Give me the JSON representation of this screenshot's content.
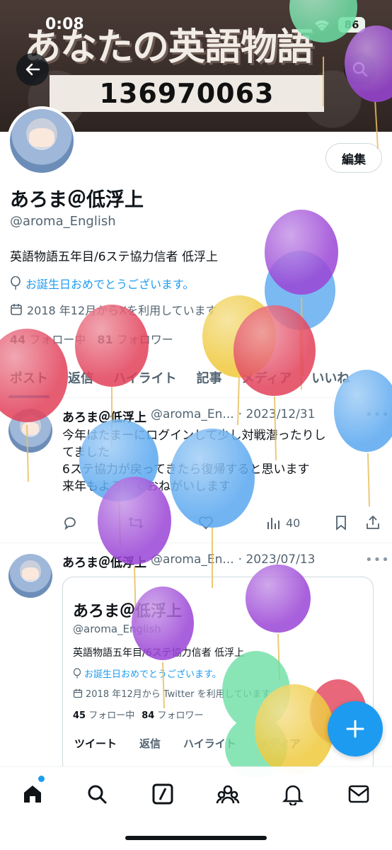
{
  "status_bar": {
    "time": "0:08",
    "battery": "86"
  },
  "banner": {
    "title": "あなたの英語物語",
    "number": "136970063"
  },
  "profile": {
    "edit_label": "編集",
    "display_name": "あろま＠低浮上",
    "handle": "@aroma_English",
    "bio": "英語物語五年目/6ステ協力信者 低浮上",
    "birthday": "お誕生日おめでとうございます。",
    "joined": "2018 年12月からXを利用しています",
    "following_count": "44",
    "following_label": "フォロー中",
    "followers_count": "81",
    "followers_label": "フォロワー"
  },
  "tabs": [
    "ポスト",
    "返信",
    "ハイライト",
    "記事",
    "メディア",
    "いいね"
  ],
  "tweets": [
    {
      "name": "あろま＠低浮上",
      "handle": "@aroma_En...",
      "date": "· 2023/12/31",
      "lines": [
        "今年はたまーにログインして少し対戦潜ったりし",
        "てました",
        "6ステ協力が戻ってきたら復帰すると思います",
        "来年もよろしくおねがいします"
      ],
      "views": "40"
    },
    {
      "name": "あろま＠低浮上",
      "handle": "@aroma_En...",
      "date": "· 2023/07/13",
      "card": {
        "name": "あろま＠低浮上",
        "handle": "@aroma_English",
        "bio": "英語物語五年目/6ステ協力信者 低浮上",
        "birthday": "お誕生日おめでとうございます。",
        "joined": "2018 年12月から Twitter を利用しています",
        "following_count": "45",
        "following_label": "フォロー中",
        "followers_count": "84",
        "followers_label": "フォロワー",
        "tabs": [
          "ツイート",
          "返信",
          "ハイライト",
          "メディア"
        ]
      }
    }
  ],
  "colors": {
    "accent": "#1d9bf0",
    "text": "#0f1419",
    "muted": "#536471",
    "balloon_purple": "#9b45d6",
    "balloon_blue": "#5aa8f0",
    "balloon_red": "#e2415a",
    "balloon_yellow": "#efc93a",
    "balloon_green": "#6ddfa4"
  },
  "icons": [
    "back-arrow-icon",
    "search-icon",
    "wifi-icon",
    "balloon-icon",
    "calendar-icon",
    "reply-icon",
    "retweet-icon",
    "like-icon",
    "views-icon",
    "bookmark-icon",
    "share-icon",
    "compose-icon",
    "home-icon",
    "grok-icon",
    "communities-icon",
    "notifications-icon",
    "messages-icon"
  ]
}
